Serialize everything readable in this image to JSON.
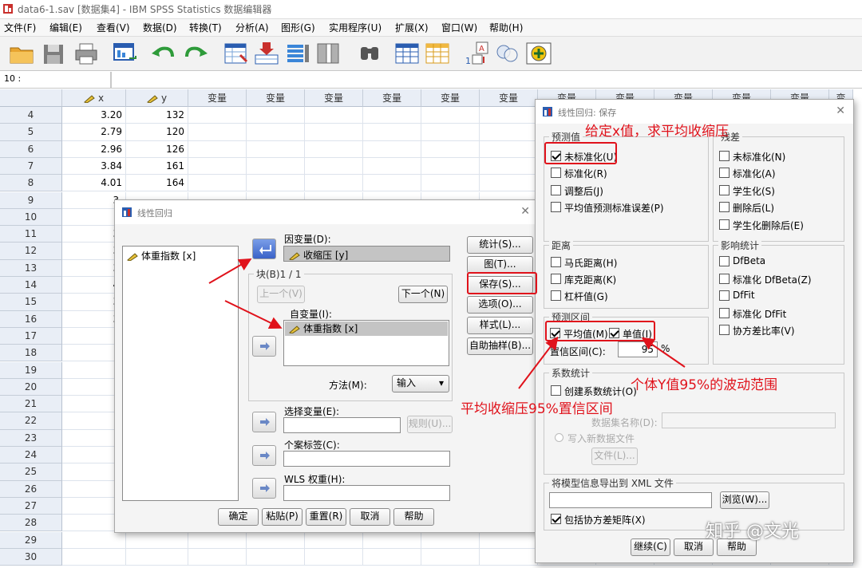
{
  "window": {
    "title": "data6-1.sav [数据集4] - IBM SPSS Statistics 数据编辑器"
  },
  "menu": [
    "文件(F)",
    "编辑(E)",
    "查看(V)",
    "数据(D)",
    "转换(T)",
    "分析(A)",
    "图形(G)",
    "实用程序(U)",
    "扩展(X)",
    "窗口(W)",
    "帮助(H)"
  ],
  "refbar": {
    "cell_ref": "10 :"
  },
  "grid": {
    "columns": [
      "x",
      "y",
      "变量",
      "变量",
      "变量",
      "变量",
      "变量",
      "变量",
      "变量",
      "变量",
      "变量",
      "变量",
      "变量",
      "变"
    ],
    "rows": [
      {
        "n": "4",
        "x": "3.20",
        "y": "132"
      },
      {
        "n": "5",
        "x": "2.79",
        "y": "120"
      },
      {
        "n": "6",
        "x": "2.96",
        "y": "126"
      },
      {
        "n": "7",
        "x": "3.84",
        "y": "161"
      },
      {
        "n": "8",
        "x": "4.01",
        "y": "164"
      },
      {
        "n": "9",
        "x": "3.",
        "y": ""
      },
      {
        "n": "10",
        "x": "3",
        "y": ""
      },
      {
        "n": "11",
        "x": "3.",
        "y": ""
      },
      {
        "n": "12",
        "x": "3.",
        "y": ""
      },
      {
        "n": "13",
        "x": "3.",
        "y": ""
      },
      {
        "n": "14",
        "x": "4.",
        "y": ""
      },
      {
        "n": "15",
        "x": "3.",
        "y": ""
      },
      {
        "n": "16",
        "x": "3.",
        "y": ""
      },
      {
        "n": "17",
        "x": "",
        "y": ""
      },
      {
        "n": "18",
        "x": "",
        "y": ""
      },
      {
        "n": "19",
        "x": "",
        "y": ""
      },
      {
        "n": "20",
        "x": "",
        "y": ""
      },
      {
        "n": "21",
        "x": "",
        "y": ""
      },
      {
        "n": "22",
        "x": "",
        "y": ""
      },
      {
        "n": "23",
        "x": "",
        "y": ""
      },
      {
        "n": "24",
        "x": "",
        "y": ""
      },
      {
        "n": "25",
        "x": "",
        "y": ""
      },
      {
        "n": "26",
        "x": "",
        "y": ""
      },
      {
        "n": "27",
        "x": "",
        "y": ""
      },
      {
        "n": "28",
        "x": "",
        "y": ""
      },
      {
        "n": "29",
        "x": "",
        "y": ""
      },
      {
        "n": "30",
        "x": "",
        "y": ""
      }
    ]
  },
  "regression_dialog": {
    "title": "线性回归",
    "source_list": [
      "体重指数 [x]"
    ],
    "dependent_label": "因变量(D):",
    "dependent_value": "收缩压 [y]",
    "block_label": "块(B)1 / 1",
    "prev_button": "上一个(V)",
    "next_button": "下一个(N)",
    "independent_label": "自变量(I):",
    "independent_value": "体重指数 [x]",
    "method_label": "方法(M):",
    "method_value": "输入",
    "selection_label": "选择变量(E):",
    "rule_button": "规则(U)...",
    "case_label": "个案标签(C):",
    "wls_label": "WLS 权重(H):",
    "side_buttons": [
      "统计(S)...",
      "图(T)...",
      "保存(S)...",
      "选项(O)...",
      "样式(L)...",
      "自助抽样(B)..."
    ],
    "bottom_buttons": [
      "确定",
      "粘贴(P)",
      "重置(R)",
      "取消",
      "帮助"
    ]
  },
  "save_dialog": {
    "title": "线性回归: 保存",
    "predicted_group": "预测值",
    "predicted": [
      {
        "label": "未标准化(U)",
        "checked": true
      },
      {
        "label": "标准化(R)",
        "checked": false
      },
      {
        "label": "调整后(J)",
        "checked": false
      },
      {
        "label": "平均值预测标准误差(P)",
        "checked": false
      }
    ],
    "residuals_group": "残差",
    "residuals": [
      {
        "label": "未标准化(N)",
        "checked": false
      },
      {
        "label": "标准化(A)",
        "checked": false
      },
      {
        "label": "学生化(S)",
        "checked": false
      },
      {
        "label": "删除后(L)",
        "checked": false
      },
      {
        "label": "学生化删除后(E)",
        "checked": false
      }
    ],
    "distance_group": "距离",
    "distances": [
      {
        "label": "马氏距离(H)",
        "checked": false
      },
      {
        "label": "库克距离(K)",
        "checked": false
      },
      {
        "label": "杠杆值(G)",
        "checked": false
      }
    ],
    "influence_group": "影响统计",
    "influence": [
      {
        "label": "DfBeta",
        "checked": false
      },
      {
        "label": "标准化 DfBeta(Z)",
        "checked": false
      },
      {
        "label": "DfFit",
        "checked": false
      },
      {
        "label": "标准化 DfFit",
        "checked": false
      },
      {
        "label": "协方差比率(V)",
        "checked": false
      }
    ],
    "interval_group": "预测区间",
    "interval_mean": {
      "label": "平均值(M)",
      "checked": true
    },
    "interval_indiv": {
      "label": "单值(I)",
      "checked": true
    },
    "confidence_label": "置信区间(C):",
    "confidence_value": "95",
    "percent": "%",
    "coef_group": "系数统计",
    "coef_create": {
      "label": "创建系数统计(O)",
      "checked": false
    },
    "dataset_label": "数据集名称(D):",
    "write_file": "写入新数据文件",
    "file_button": "文件(L)...",
    "xml_group": "将模型信息导出到 XML 文件",
    "browse_button": "浏览(W)...",
    "cov_matrix": {
      "label": "包括协方差矩阵(X)",
      "checked": true
    },
    "bottom_buttons": [
      "继续(C)",
      "取消",
      "帮助"
    ]
  },
  "annotations": {
    "predict_mean": "给定x值，求平均收缩压",
    "individual_range": "个体Y值95%的波动范围",
    "mean_ci": "平均收缩压95%置信区间"
  },
  "watermark": "知乎 @文光",
  "colors": {
    "annotation_red": "#e0121b",
    "grid_header": "#e9eef6",
    "dialog_bg": "#f4f4f4"
  }
}
